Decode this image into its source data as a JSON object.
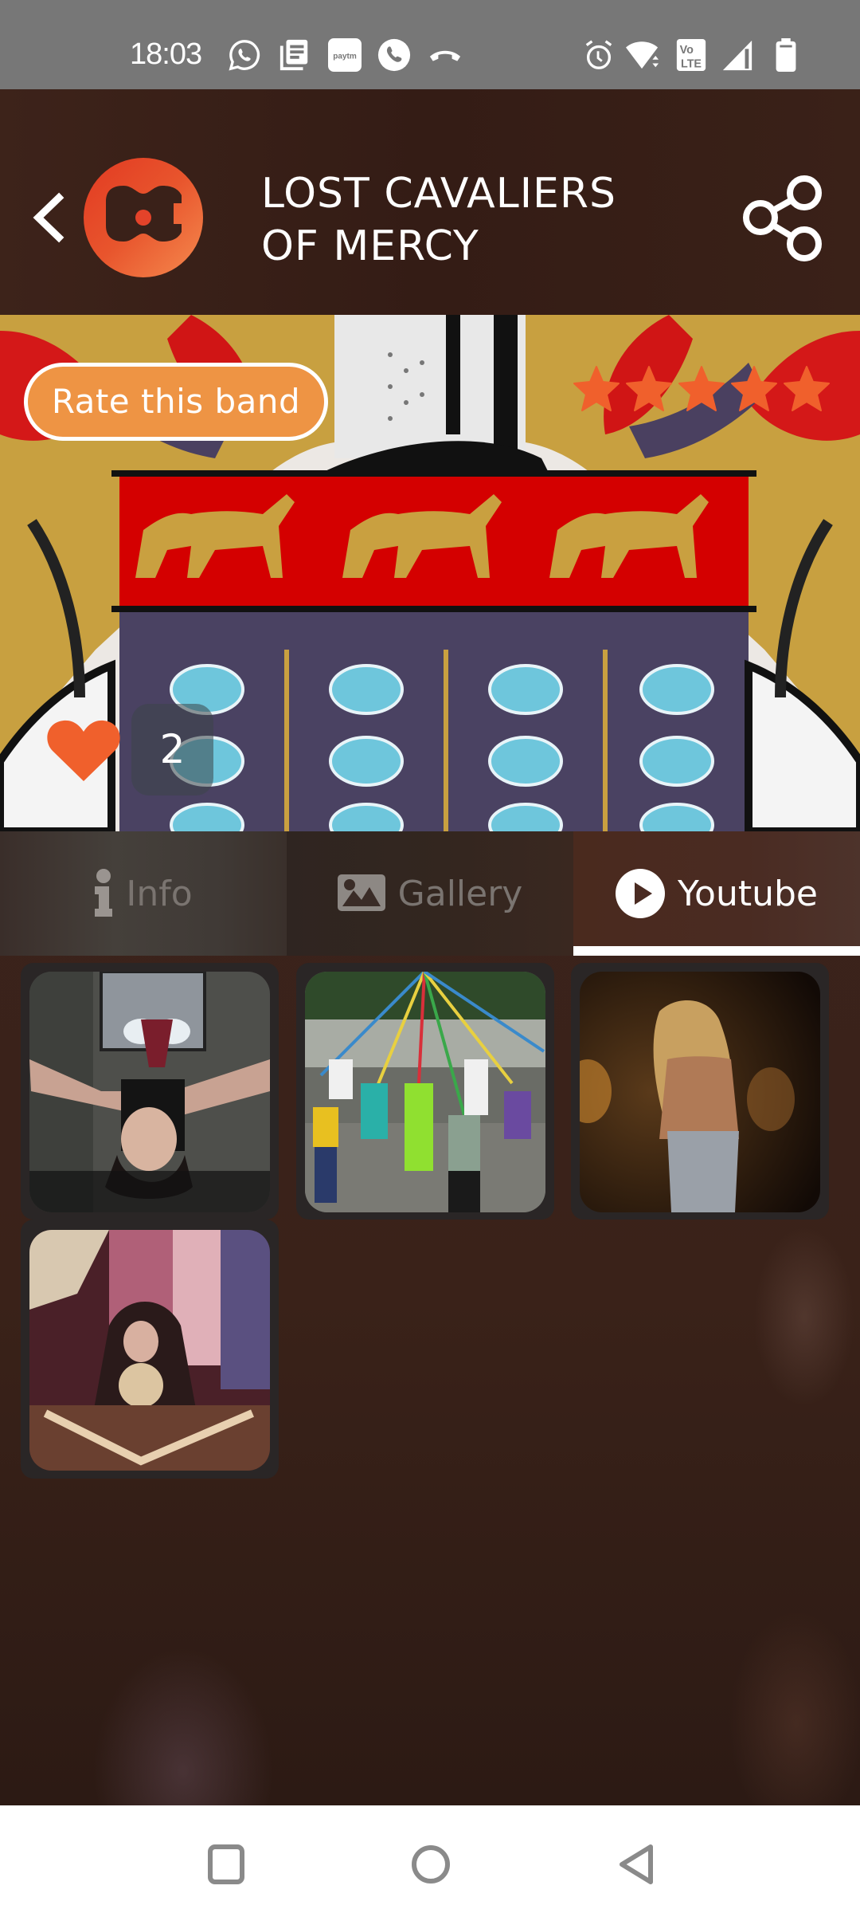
{
  "status_bar": {
    "time": "18:03",
    "left_icons": [
      "whatsapp-icon",
      "news-icon",
      "paytm-icon",
      "phone-icon",
      "call-end-icon"
    ],
    "paytm_label": "paytm",
    "right_icons": [
      "alarm-icon",
      "wifi-icon",
      "volte-icon",
      "signal-icon",
      "battery-icon"
    ],
    "volte_label_top": "Vo",
    "volte_label_bottom": "LTE"
  },
  "header": {
    "back_icon": "chevron-left-icon",
    "logo": "app-logo-guitar-c",
    "title_line1": "LOST CAVALIERS",
    "title_line2": "OF MERCY",
    "share_icon": "share-icon"
  },
  "banner": {
    "image": "coat-of-arms-with-lions",
    "rate_button_label": "Rate this band",
    "rating": {
      "value": 5,
      "max": 5
    },
    "like_count": "2",
    "accent_color": "#f0602c",
    "rate_button_color": "#ee9444"
  },
  "tabs": [
    {
      "label": "Info",
      "icon": "info-icon",
      "active": false
    },
    {
      "label": "Gallery",
      "icon": "image-icon",
      "active": false
    },
    {
      "label": "Youtube",
      "icon": "play-circle-icon",
      "active": true
    }
  ],
  "videos": [
    {
      "thumbnail": "person-upside-down"
    },
    {
      "thumbnail": "maypole-dance-children"
    },
    {
      "thumbnail": "woman-walking-at-night"
    },
    {
      "thumbnail": "fortune-teller-crystal-ball"
    }
  ],
  "nav_bar": {
    "buttons": [
      "recents-button",
      "home-button",
      "back-button"
    ]
  }
}
